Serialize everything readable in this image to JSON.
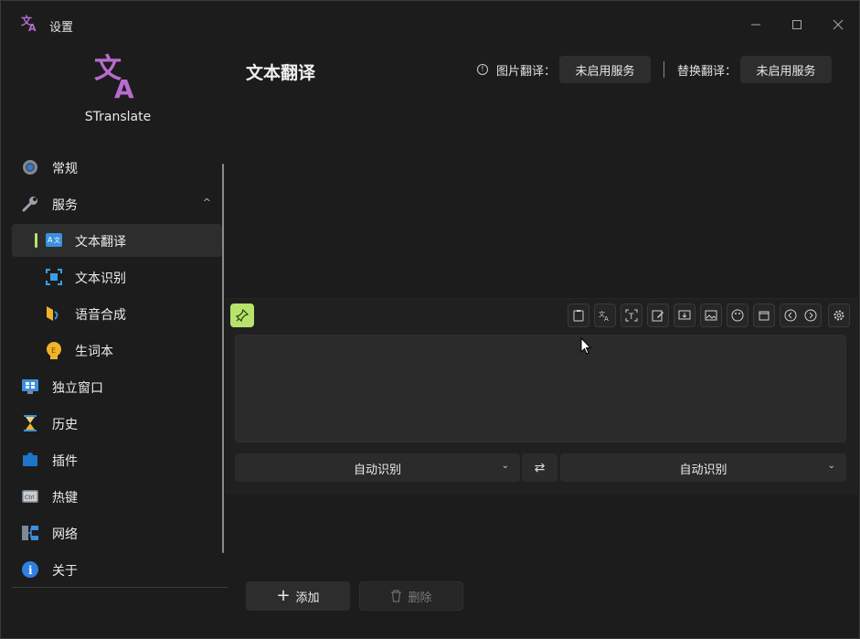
{
  "window": {
    "title": "设置"
  },
  "app": {
    "name": "STranslate"
  },
  "sidebar": {
    "items": [
      {
        "label": "常规"
      },
      {
        "label": "服务"
      },
      {
        "label": "文本翻译"
      },
      {
        "label": "文本识别"
      },
      {
        "label": "语音合成"
      },
      {
        "label": "生词本"
      },
      {
        "label": "独立窗口"
      },
      {
        "label": "历史"
      },
      {
        "label": "插件"
      },
      {
        "label": "热键"
      },
      {
        "label": "网络"
      },
      {
        "label": "关于"
      }
    ],
    "selected": "文本翻译",
    "services_expanded": true
  },
  "main": {
    "title": "文本翻译",
    "image_translate": {
      "label": "图片翻译：",
      "value": "未启用服务"
    },
    "replace_translate": {
      "label": "替换翻译：",
      "value": "未启用服务"
    }
  },
  "panel": {
    "source_lang": "自动识别",
    "target_lang": "自动识别",
    "swap_icon": "⇄",
    "input_text": ""
  },
  "actions": {
    "add_label": "添加",
    "delete_label": "删除",
    "add_icon": "+",
    "delete_icon": "trash-icon"
  },
  "colors": {
    "accent": "#b7e36a",
    "logo": "#b96bd0",
    "background": "#1c1c1c",
    "panel": "#2b2b2b"
  }
}
